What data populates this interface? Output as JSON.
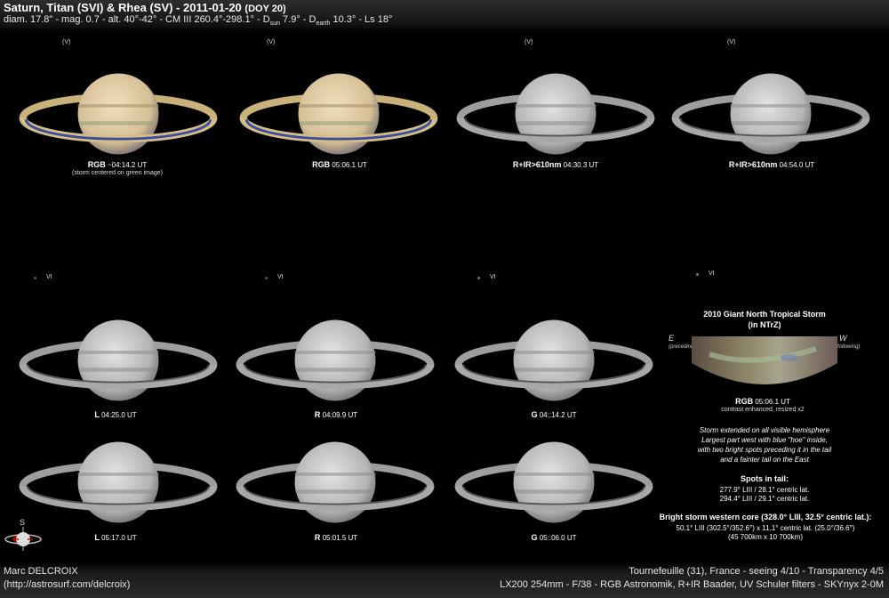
{
  "header": {
    "title": "Saturn, Titan (SVI) & Rhea (SV) - 2011-01-20",
    "doy": "(DOY 20)",
    "subtitle": {
      "part1": "diam. 17.8\" - mag. 0.7 - alt. 40°-42° - CM III 260.4°-298.1° - D",
      "sub_sun": "sun",
      "part2": " 7.9° - D",
      "sub_earth": "earth",
      "part3": " 10.3° - Ls 18°"
    }
  },
  "moon_labels": {
    "top": "(V)",
    "lower": "VI"
  },
  "images": [
    {
      "filter": "RGB",
      "time": "~04:14.2 UT",
      "note": "(storm centered on green image)",
      "palette": "color"
    },
    {
      "filter": "RGB",
      "time": "05:06.1 UT",
      "note": "",
      "palette": "color"
    },
    {
      "filter": "R+IR>610nm",
      "time": "04:30.3 UT",
      "note": "",
      "palette": "grey"
    },
    {
      "filter": "R+IR>610nm",
      "time": "04:54.0 UT",
      "note": "",
      "palette": "grey"
    },
    {
      "filter": "L",
      "time": "04:25.0 UT",
      "note": "",
      "palette": "grey"
    },
    {
      "filter": "R",
      "time": "04:09.9 UT",
      "note": "",
      "palette": "grey"
    },
    {
      "filter": "G",
      "time": "04::14.2 UT",
      "note": "",
      "palette": "grey"
    },
    {
      "filter": "L",
      "time": "05:17.0 UT",
      "note": "",
      "palette": "grey"
    },
    {
      "filter": "R",
      "time": "05:01.5 UT",
      "note": "",
      "palette": "grey"
    },
    {
      "filter": "G",
      "time": "05::06.0 UT",
      "note": "",
      "palette": "grey"
    }
  ],
  "storm_panel": {
    "title_line1": "2010 Giant North Tropical Storm",
    "title_line2": "(in NTrZ)",
    "east": "E",
    "east_note": "(preceding)",
    "west": "W",
    "west_note": "(following)",
    "caption_filter": "RGB",
    "caption_time": "05:06.1 UT",
    "caption_note": "contrast enhanced, resized x2",
    "description": [
      "Storm extended on all visible hemisphere",
      "Largest part west with blue \"hoe\" inside,",
      "with two bright spots preceding it in the tail",
      "and a fainter tail on the East"
    ],
    "spots_title": "Spots in tail:",
    "spots": [
      "277.9° LIII / 28.1° centric lat.",
      "294.4° LIII / 29.1° centric lat."
    ],
    "core_title": "Bright storm western core (328.0° LIII, 32.5° centric lat.):",
    "core_lines": [
      "50.1° LIII (302.5°/352.6°) x 11.1° centric lat. (25.0°/36.6°)",
      "(45 700km x 10 700km)"
    ]
  },
  "orientation": {
    "label": "S"
  },
  "footer": {
    "author": "Marc DELCROIX",
    "url": "(http://astrosurf.com/delcroix)",
    "location": "Tournefeuille (31), France - seeing 4/10 - Transparency 4/5",
    "equipment": "LX200 254mm - F/38 -  RGB Astronomik, R+IR Baader, UV Schuler filters - SKYnyx 2-0M"
  }
}
